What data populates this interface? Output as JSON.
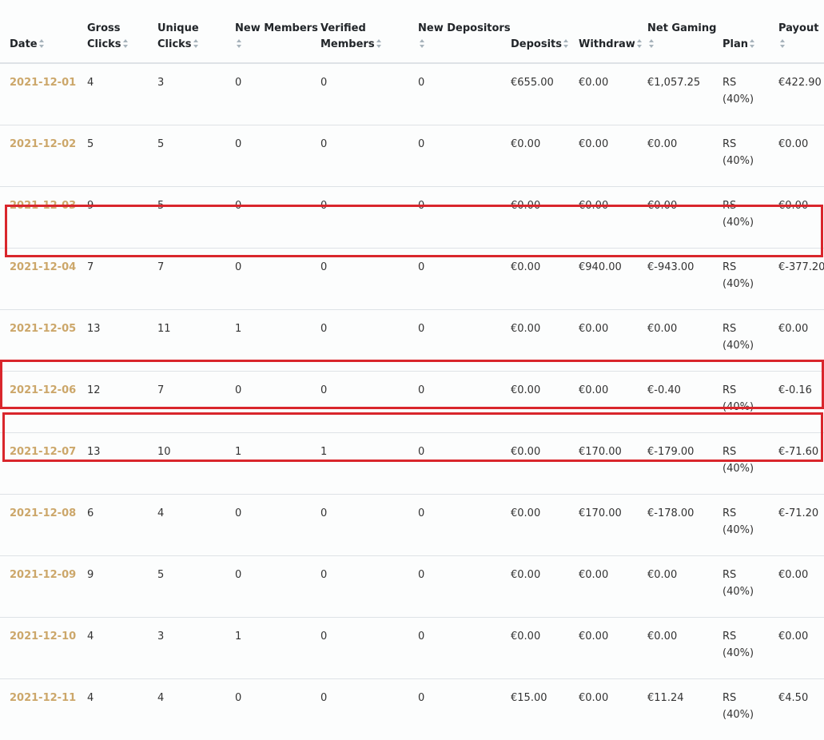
{
  "columns": [
    {
      "id": "date",
      "label": "Date"
    },
    {
      "id": "gross_clicks",
      "label": "Gross Clicks"
    },
    {
      "id": "unique_clicks",
      "label": "Unique Clicks"
    },
    {
      "id": "new_members",
      "label": "New Members"
    },
    {
      "id": "verified_members",
      "label": "Verified Members"
    },
    {
      "id": "new_depositors",
      "label": "New Depositors"
    },
    {
      "id": "deposits",
      "label": "Deposits"
    },
    {
      "id": "withdraw",
      "label": "Withdraw"
    },
    {
      "id": "net_gaming",
      "label": "Net Gaming"
    },
    {
      "id": "plan",
      "label": "Plan"
    },
    {
      "id": "payout",
      "label": "Payout"
    }
  ],
  "rows": [
    {
      "date": "2021-12-01",
      "gross_clicks": "4",
      "unique_clicks": "3",
      "new_members": "0",
      "verified_members": "0",
      "new_depositors": "0",
      "deposits": "€655.00",
      "withdraw": "€0.00",
      "net_gaming": "€1,057.25",
      "plan_name": "RS",
      "plan_pct": "(40%)",
      "payout": "€422.90"
    },
    {
      "date": "2021-12-02",
      "gross_clicks": "5",
      "unique_clicks": "5",
      "new_members": "0",
      "verified_members": "0",
      "new_depositors": "0",
      "deposits": "€0.00",
      "withdraw": "€0.00",
      "net_gaming": "€0.00",
      "plan_name": "RS",
      "plan_pct": "(40%)",
      "payout": "€0.00"
    },
    {
      "date": "2021-12-03",
      "gross_clicks": "9",
      "unique_clicks": "5",
      "new_members": "0",
      "verified_members": "0",
      "new_depositors": "0",
      "deposits": "€0.00",
      "withdraw": "€0.00",
      "net_gaming": "€0.00",
      "plan_name": "RS",
      "plan_pct": "(40%)",
      "payout": "€0.00"
    },
    {
      "date": "2021-12-04",
      "gross_clicks": "7",
      "unique_clicks": "7",
      "new_members": "0",
      "verified_members": "0",
      "new_depositors": "0",
      "deposits": "€0.00",
      "withdraw": "€940.00",
      "net_gaming": "€-943.00",
      "plan_name": "RS",
      "plan_pct": "(40%)",
      "payout": "€-377.20"
    },
    {
      "date": "2021-12-05",
      "gross_clicks": "13",
      "unique_clicks": "11",
      "new_members": "1",
      "verified_members": "0",
      "new_depositors": "0",
      "deposits": "€0.00",
      "withdraw": "€0.00",
      "net_gaming": "€0.00",
      "plan_name": "RS",
      "plan_pct": "(40%)",
      "payout": "€0.00"
    },
    {
      "date": "2021-12-06",
      "gross_clicks": "12",
      "unique_clicks": "7",
      "new_members": "0",
      "verified_members": "0",
      "new_depositors": "0",
      "deposits": "€0.00",
      "withdraw": "€0.00",
      "net_gaming": "€-0.40",
      "plan_name": "RS",
      "plan_pct": "(40%)",
      "payout": "€-0.16"
    },
    {
      "date": "2021-12-07",
      "gross_clicks": "13",
      "unique_clicks": "10",
      "new_members": "1",
      "verified_members": "1",
      "new_depositors": "0",
      "deposits": "€0.00",
      "withdraw": "€170.00",
      "net_gaming": "€-179.00",
      "plan_name": "RS",
      "plan_pct": "(40%)",
      "payout": "€-71.60"
    },
    {
      "date": "2021-12-08",
      "gross_clicks": "6",
      "unique_clicks": "4",
      "new_members": "0",
      "verified_members": "0",
      "new_depositors": "0",
      "deposits": "€0.00",
      "withdraw": "€170.00",
      "net_gaming": "€-178.00",
      "plan_name": "RS",
      "plan_pct": "(40%)",
      "payout": "€-71.20"
    },
    {
      "date": "2021-12-09",
      "gross_clicks": "9",
      "unique_clicks": "5",
      "new_members": "0",
      "verified_members": "0",
      "new_depositors": "0",
      "deposits": "€0.00",
      "withdraw": "€0.00",
      "net_gaming": "€0.00",
      "plan_name": "RS",
      "plan_pct": "(40%)",
      "payout": "€0.00"
    },
    {
      "date": "2021-12-10",
      "gross_clicks": "4",
      "unique_clicks": "3",
      "new_members": "1",
      "verified_members": "0",
      "new_depositors": "0",
      "deposits": "€0.00",
      "withdraw": "€0.00",
      "net_gaming": "€0.00",
      "plan_name": "RS",
      "plan_pct": "(40%)",
      "payout": "€0.00"
    },
    {
      "date": "2021-12-11",
      "gross_clicks": "4",
      "unique_clicks": "4",
      "new_members": "0",
      "verified_members": "0",
      "new_depositors": "0",
      "deposits": "€15.00",
      "withdraw": "€0.00",
      "net_gaming": "€11.24",
      "plan_name": "RS",
      "plan_pct": "(40%)",
      "payout": "€4.50"
    }
  ],
  "highlighted_dates": [
    "2021-12-04",
    "2021-12-07",
    "2021-12-08"
  ],
  "colors": {
    "date_link": "#cca76a",
    "highlight_border": "#d9262c",
    "sort_icon": "#a7b3bb",
    "row_divider": "#dee2e6"
  }
}
